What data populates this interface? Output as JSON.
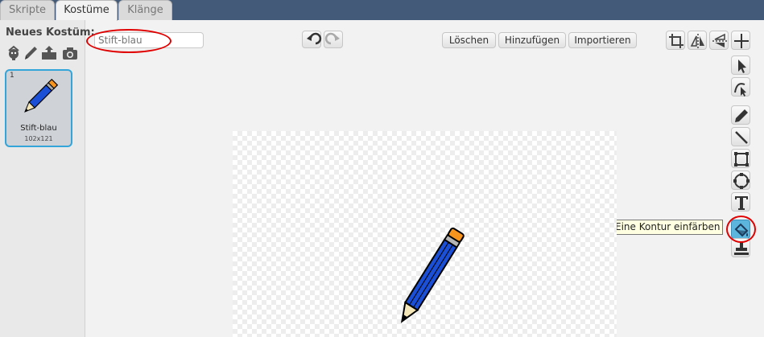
{
  "tabs": [
    {
      "label": "Skripte",
      "active": false
    },
    {
      "label": "Kostüme",
      "active": true
    },
    {
      "label": "Klänge",
      "active": false
    }
  ],
  "sidebar": {
    "new_costume_label": "Neues Kostüm:",
    "icons": [
      "sprite-library-icon",
      "paint-brush-icon",
      "upload-icon",
      "camera-icon"
    ],
    "costume": {
      "number": "1",
      "name": "Stift-blau",
      "size": "102x121"
    }
  },
  "editor": {
    "costume_name_placeholder": "Stift-blau",
    "buttons": {
      "clear": "Löschen",
      "add": "Hinzufügen",
      "import": "Importieren"
    },
    "tooltip": "Eine Kontur einfärben"
  },
  "colors": {
    "accent": "#34a5d9",
    "topbar": "#435a78",
    "annotation": "#e00000",
    "pencil": "#1a4fd6"
  }
}
